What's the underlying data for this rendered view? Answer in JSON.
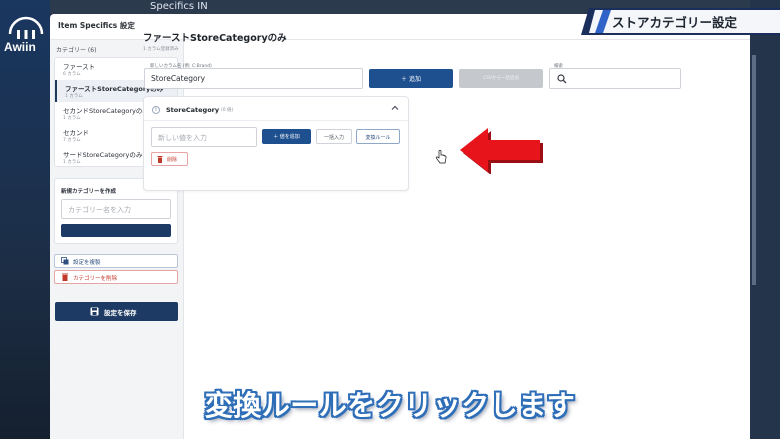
{
  "background": {
    "behind_window_title": "Specifics IN"
  },
  "logo": {
    "text": "Awiin"
  },
  "modal": {
    "title": "Item Specifics 設定"
  },
  "sidebar": {
    "heading": "カテゴリー (6)",
    "items": [
      {
        "name": "ファースト",
        "count": "6 カラム",
        "active": false
      },
      {
        "name": "ファーストStoreCategoryのみ",
        "count": "1 カラム",
        "active": true
      },
      {
        "name": "セカンドStoreCategoryのみ",
        "count": "1 カラム",
        "active": false
      },
      {
        "name": "セカンド",
        "count": "7 カラム",
        "active": false
      },
      {
        "name": "サードStoreCategoryのみ",
        "count": "1 カラム",
        "active": false
      }
    ],
    "new_category": {
      "label": "新規カテゴリーを作成",
      "placeholder": "カテゴリー名を入力"
    },
    "copy_settings": "設定を複製",
    "delete_category": "カテゴリーを削除",
    "save_settings": "設定を保存"
  },
  "main": {
    "title": "ファーストStoreCategoryのみ",
    "subtitle": "1 カラム登録済み",
    "column_name_label": "新しいカラム名 (例: C:Brand)",
    "column_name_value": "StoreCategory",
    "add_button": "＋ 追加",
    "disabled_button": "CSVから一括追加",
    "search_label": "検索",
    "card": {
      "title": "StoreCategory",
      "count": "(0 値)",
      "value_placeholder": "新しい値を入力",
      "add_value_button": "＋ 値を追加",
      "bulk_button": "一括入力",
      "rule_button": "変換ルール",
      "delete_button": "削除"
    }
  },
  "banner": {
    "text": "ストアカテゴリー設定"
  },
  "caption": {
    "text": "変換ルールをクリックします"
  },
  "colors": {
    "primary": "#1e4f8f",
    "navy": "#1c3a63",
    "danger": "#c0392b",
    "arrow_red": "#e8141c",
    "caption_outline": "#2f6fb8"
  }
}
